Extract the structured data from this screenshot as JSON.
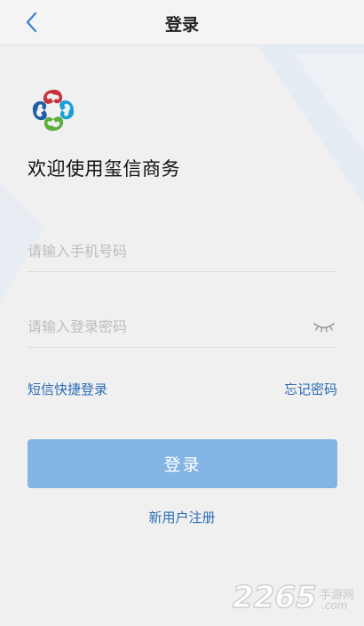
{
  "navbar": {
    "title": "登录",
    "back_icon": "chevron-left-icon"
  },
  "welcome": "欢迎使用玺信商务",
  "form": {
    "phone_placeholder": "请输入手机号码",
    "phone_value": "",
    "password_placeholder": "请输入登录密码",
    "password_value": "",
    "toggle_icon": "eye-closed-icon"
  },
  "links": {
    "sms_login": "短信快捷登录",
    "forgot_password": "忘记密码"
  },
  "login_button": "登录",
  "register_link": "新用户注册",
  "watermark": {
    "number": "2265",
    "cn": "手游网",
    "com": ".com"
  },
  "colors": {
    "accent": "#2c6cb5",
    "button": "#82b4e4",
    "background": "#f0f0f0"
  }
}
